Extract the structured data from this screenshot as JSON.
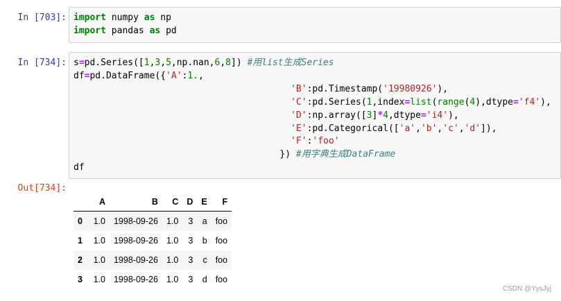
{
  "cells": [
    {
      "prompt": "In  [703]:",
      "lines": [
        [
          [
            "kw",
            "import"
          ],
          [
            "",
            " numpy "
          ],
          [
            "kw",
            "as"
          ],
          [
            "",
            " np"
          ]
        ],
        [
          [
            "kw",
            "import"
          ],
          [
            "",
            " pandas "
          ],
          [
            "kw",
            "as"
          ],
          [
            "",
            " pd"
          ]
        ]
      ]
    },
    {
      "prompt": "In  [734]:",
      "lines": [
        [
          [
            "",
            "s"
          ],
          [
            "op",
            "="
          ],
          [
            "",
            "pd.Series(["
          ],
          [
            "num",
            "1"
          ],
          [
            "",
            ","
          ],
          [
            "num",
            "3"
          ],
          [
            "",
            ","
          ],
          [
            "num",
            "5"
          ],
          [
            "",
            ",np.nan,"
          ],
          [
            "num",
            "6"
          ],
          [
            "",
            ","
          ],
          [
            "num",
            "8"
          ],
          [
            "",
            "]) "
          ],
          [
            "cm",
            "#用list生成Series"
          ]
        ],
        [
          [
            "",
            "df"
          ],
          [
            "op",
            "="
          ],
          [
            "",
            "pd.DataFrame({"
          ],
          [
            "str",
            "'A'"
          ],
          [
            "",
            ":"
          ],
          [
            "num",
            "1."
          ],
          [
            "",
            ","
          ]
        ],
        [
          [
            "",
            "                                        "
          ],
          [
            "str",
            "'B'"
          ],
          [
            "",
            ":pd.Timestamp("
          ],
          [
            "str",
            "'19980926'"
          ],
          [
            "",
            "),"
          ]
        ],
        [
          [
            "",
            "                                        "
          ],
          [
            "str",
            "'C'"
          ],
          [
            "",
            ":pd.Series("
          ],
          [
            "num",
            "1"
          ],
          [
            "",
            ",index"
          ],
          [
            "op",
            "="
          ],
          [
            "bi",
            "list"
          ],
          [
            "",
            "("
          ],
          [
            "bi",
            "range"
          ],
          [
            "",
            "("
          ],
          [
            "num",
            "4"
          ],
          [
            "",
            "),dtype"
          ],
          [
            "op",
            "="
          ],
          [
            "str",
            "'f4'"
          ],
          [
            "",
            "),"
          ]
        ],
        [
          [
            "",
            "                                        "
          ],
          [
            "str",
            "'D'"
          ],
          [
            "",
            ":np.array(["
          ],
          [
            "num",
            "3"
          ],
          [
            "",
            "]"
          ],
          [
            "op",
            "*"
          ],
          [
            "num",
            "4"
          ],
          [
            "",
            ",dtype"
          ],
          [
            "op",
            "="
          ],
          [
            "str",
            "'i4'"
          ],
          [
            "",
            "),"
          ]
        ],
        [
          [
            "",
            "                                        "
          ],
          [
            "str",
            "'E'"
          ],
          [
            "",
            ":pd.Categorical(["
          ],
          [
            "str",
            "'a'"
          ],
          [
            "",
            ","
          ],
          [
            "str",
            "'b'"
          ],
          [
            "",
            ","
          ],
          [
            "str",
            "'c'"
          ],
          [
            "",
            ","
          ],
          [
            "str",
            "'d'"
          ],
          [
            "",
            "]),"
          ]
        ],
        [
          [
            "",
            "                                        "
          ],
          [
            "str",
            "'F'"
          ],
          [
            "",
            ":"
          ],
          [
            "str",
            "'foo'"
          ]
        ],
        [
          [
            "",
            "                                      "
          ],
          [
            "",
            "}) "
          ],
          [
            "cm",
            "#用字典生成DataFrame"
          ]
        ],
        [
          [
            "",
            "df"
          ]
        ]
      ]
    }
  ],
  "output": {
    "prompt": "Out[734]:",
    "columns": [
      "",
      "A",
      "B",
      "C",
      "D",
      "E",
      "F"
    ],
    "rows": [
      [
        "0",
        "1.0",
        "1998-09-26",
        "1.0",
        "3",
        "a",
        "foo"
      ],
      [
        "1",
        "1.0",
        "1998-09-26",
        "1.0",
        "3",
        "b",
        "foo"
      ],
      [
        "2",
        "1.0",
        "1998-09-26",
        "1.0",
        "3",
        "c",
        "foo"
      ],
      [
        "3",
        "1.0",
        "1998-09-26",
        "1.0",
        "3",
        "d",
        "foo"
      ]
    ]
  },
  "watermark": "CSDN @YysJyj"
}
